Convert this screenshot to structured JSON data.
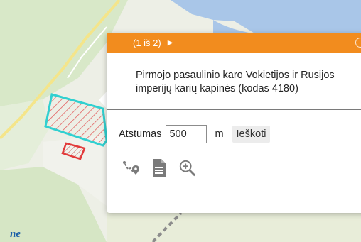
{
  "popup": {
    "pager": "(1 iš 2)",
    "next_icon": "play-triangle-icon",
    "title_line1": "Pirmojo pasaulinio karo Vokietijos ir Rusijos",
    "title_line2": "imperijų karių kapinės (kodas 4180)",
    "distance_label": "Atstumas",
    "distance_value": "500",
    "unit": "m",
    "search_label": "Ieškoti",
    "tools": [
      "route-icon",
      "document-icon",
      "zoom-in-icon"
    ],
    "header_color": "#f28c1e"
  },
  "map": {
    "place_label": "ne",
    "parcel_outline_color": "#31d0d0",
    "parcel_small_color": "#e23a3a",
    "water_color": "#a9c6e8"
  }
}
